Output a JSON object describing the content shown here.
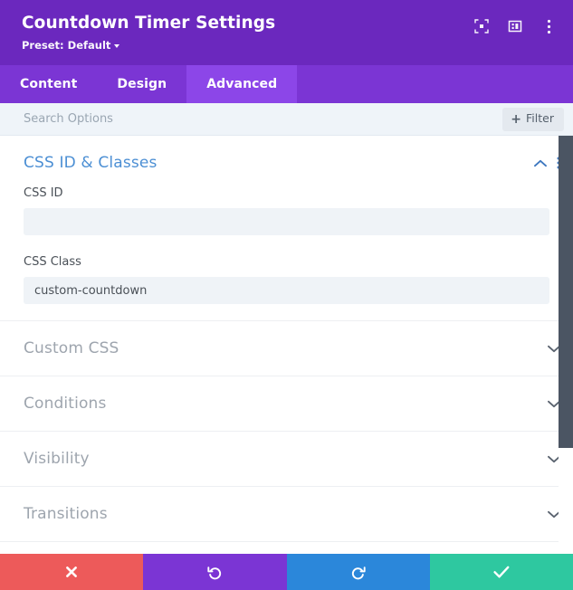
{
  "header": {
    "title": "Countdown Timer Settings",
    "preset_label": "Preset: Default",
    "icons": [
      {
        "name": "expand-icon"
      },
      {
        "name": "layout-view-icon"
      },
      {
        "name": "more-options-icon"
      }
    ]
  },
  "tabs": [
    {
      "label": "Content",
      "active": false
    },
    {
      "label": "Design",
      "active": false
    },
    {
      "label": "Advanced",
      "active": true
    }
  ],
  "search": {
    "placeholder": "Search Options",
    "value": "",
    "filter_label": "Filter",
    "filter_plus": "+"
  },
  "sections": {
    "open": {
      "title": "CSS ID & Classes",
      "fields": [
        {
          "label": "CSS ID",
          "value": "",
          "placeholder": ""
        },
        {
          "label": "CSS Class",
          "value": "custom-countdown",
          "placeholder": ""
        }
      ]
    },
    "collapsed": [
      {
        "title": "Custom CSS"
      },
      {
        "title": "Conditions"
      },
      {
        "title": "Visibility"
      },
      {
        "title": "Transitions"
      }
    ]
  },
  "footer": {
    "buttons": [
      {
        "name": "cancel-button",
        "icon": "close-icon",
        "color": "#ED5A5A"
      },
      {
        "name": "undo-button",
        "icon": "undo-icon",
        "color": "#7B35D4"
      },
      {
        "name": "redo-button",
        "icon": "redo-icon",
        "color": "#2B87DA"
      },
      {
        "name": "save-button",
        "icon": "check-icon",
        "color": "#2EC8A0"
      }
    ]
  },
  "colors": {
    "header_purple": "#6B28BE",
    "tabbar_purple": "#7B35D4",
    "active_tab_purple": "#8C46E8",
    "section_open_blue": "#4C8FD4",
    "section_closed_gray": "#9EA5AE",
    "search_bg": "#EFF4F9",
    "input_bg": "#EFF3F7",
    "scrollbar": "#4B5563"
  }
}
